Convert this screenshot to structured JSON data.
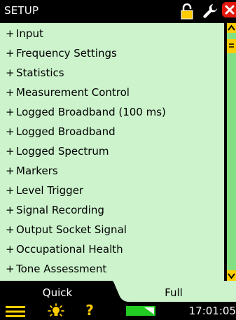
{
  "header": {
    "title": "SETUP",
    "icons": [
      "lock-icon",
      "wrench-icon",
      "close-icon"
    ]
  },
  "menu": {
    "items": [
      {
        "prefix": "+",
        "label": "Input"
      },
      {
        "prefix": "+",
        "label": "Frequency Settings"
      },
      {
        "prefix": "+",
        "label": "Statistics"
      },
      {
        "prefix": "+",
        "label": "Measurement Control"
      },
      {
        "prefix": "+",
        "label": "Logged Broadband (100 ms)"
      },
      {
        "prefix": "+",
        "label": "Logged Broadband"
      },
      {
        "prefix": "+",
        "label": "Logged Spectrum"
      },
      {
        "prefix": "+",
        "label": "Markers"
      },
      {
        "prefix": "+",
        "label": "Level Trigger"
      },
      {
        "prefix": "+",
        "label": "Signal Recording"
      },
      {
        "prefix": "+",
        "label": "Output Socket Signal"
      },
      {
        "prefix": "+",
        "label": "Occupational Health"
      },
      {
        "prefix": "+",
        "label": "Tone Assessment"
      }
    ]
  },
  "tabs": [
    {
      "label": "Quick",
      "active": false
    },
    {
      "label": "Full",
      "active": true
    }
  ],
  "status": {
    "time": "17:01:05",
    "icons": [
      "menu-icon",
      "bulb-icon",
      "help-icon",
      "battery-icon"
    ],
    "help_glyph": "?"
  },
  "colors": {
    "list_background": "#ccf3cc",
    "accent": "#ffcc00",
    "scrollbar": "#82e082",
    "close_button": "#e3170d",
    "battery": "#22cc22"
  }
}
